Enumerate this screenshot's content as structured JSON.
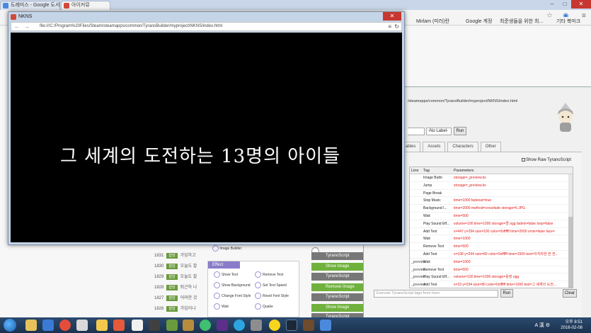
{
  "bg_browser": {
    "tabs": [
      "도레미스 - Google 도서",
      "아이커뮤"
    ],
    "address_icons": [
      "star-icon",
      "menu-icon"
    ],
    "bookmarks": [
      "Mirlam (미러)란",
      "Google 계정",
      "최준생들을 위한 최...",
      "기타 북마크"
    ]
  },
  "bg_list": {
    "rows": [
      {
        "num": "1831",
        "badge": "잡담",
        "text": "가입하고"
      },
      {
        "num": "1830",
        "badge": "잡담",
        "text": "오늘도 잘"
      },
      {
        "num": "1829",
        "badge": "잡담",
        "text": "오늘도 잘"
      },
      {
        "num": "1828",
        "badge": "잡담",
        "text": "퇴근하 나"
      },
      {
        "num": "1827",
        "badge": "잡담",
        "text": "어려한 것"
      },
      {
        "num": "1826",
        "badge": "잡담",
        "text": "가입이나"
      }
    ]
  },
  "palette": {
    "image_builder": "Image Builder",
    "header": "Effect",
    "items": [
      "Show Text",
      "Remove Text",
      "Show Background",
      "Set Text Speed",
      "Change Font Style",
      "Reset Font Style",
      "Wait",
      "Quake"
    ]
  },
  "flow_blocks": [
    "TyranoScript",
    "Show Image",
    "TyranoScript",
    "Remove Image",
    "TyranoScript",
    "Show Image",
    "TyranoScript"
  ],
  "game_window": {
    "title": "NKNS",
    "address": "file:///C:/Program%20Files/Steam/steamapps/common/TyranoBuilder/myproject/NKNS/index.html",
    "game_text": "그 세계의 도전하는 13명의 아이들"
  },
  "editor": {
    "path": "/steamapps/common/TyranoBuilder/myproject/NKNS/index.html",
    "label_select": "-No Label-",
    "run_label": "Run",
    "tabs": [
      "ables",
      "Assets",
      "Characters",
      "Other"
    ],
    "show_raw_label": "Show Raw TyranoScript",
    "headers": {
      "line": "Line",
      "tag": "Tag",
      "params": "Parameters"
    },
    "rows": [
      {
        "line": "",
        "tag": "Image Buttn",
        "params": "storage=_preview.ks"
      },
      {
        "line": "",
        "tag": "Jump",
        "params": "storage=_preview.ks"
      },
      {
        "line": "",
        "tag": "Page Break",
        "params": ""
      },
      {
        "line": "",
        "tag": "Stop Music",
        "params": "time=1000 fadeout=true"
      },
      {
        "line": "",
        "tag": "Background I...",
        "params": "time=2000 method=crossfade storage=5.JPG"
      },
      {
        "line": "",
        "tag": "Wait",
        "params": "time=500"
      },
      {
        "line": "",
        "tag": "Play Sound Eff...",
        "params": "volume=100 time=1000 storage=쿵.ogg fadein=false loop=false"
      },
      {
        "line": "",
        "tag": "Add Text",
        "params": "x=447 y=294 size=100 color=0xffffff time=2000 xmin=false face="
      },
      {
        "line": "",
        "tag": "Wait",
        "params": "time=1000"
      },
      {
        "line": "",
        "tag": "Remove Text",
        "params": "time=500"
      },
      {
        "line": "",
        "tag": "Add Text",
        "params": "x=108 y=294 size=80 color=0xffffff time=1500 text=아지라한 한 전..."
      },
      {
        "line": "_preview",
        "tag": "Wait",
        "params": "time=1000"
      },
      {
        "line": "_preview",
        "tag": "Remove Text",
        "params": "time=500"
      },
      {
        "line": "_preview",
        "tag": "Play Sound Eff...",
        "params": "volume=100 time=1000 storage=웅장.ogg"
      },
      {
        "line": "_preview",
        "tag": "Add Text",
        "params": "x=33 y=294 size=80 color=0xffffff time=1000 text=그 세계의 도전..."
      },
      {
        "line": "_preview",
        "tag": "Wait",
        "params": "time=2000"
      }
    ],
    "exec_placeholder": "Execute TyranoScript tags from here",
    "clear_label": "Clear"
  },
  "taskbar": {
    "ime": "A 漢 ⚙",
    "time": "오후 8:51",
    "date": "2016-02-08"
  },
  "colors": {
    "accent_green": "#6fb13c",
    "param_red": "#e02020",
    "palette_purple": "#8a7cc9",
    "close_red": "#c7372f"
  }
}
